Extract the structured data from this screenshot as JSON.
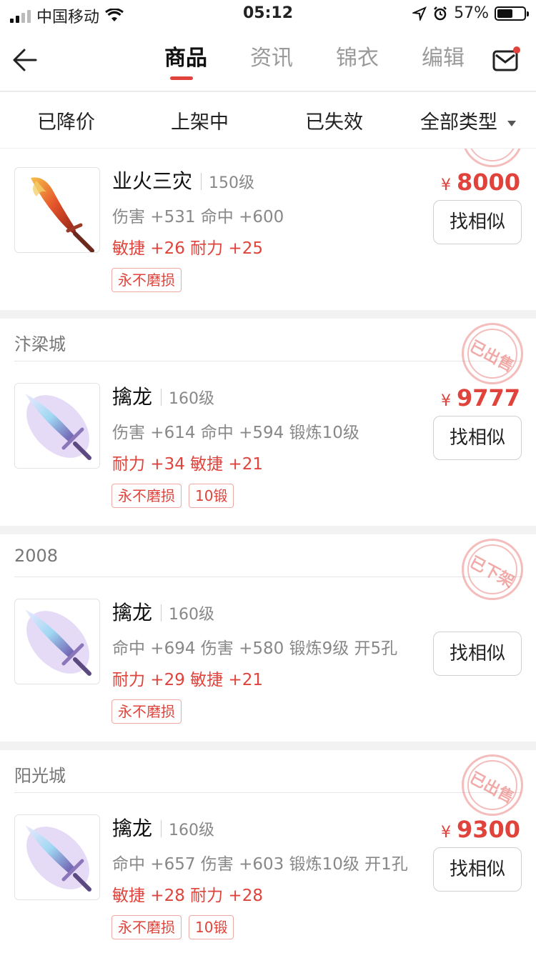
{
  "status_bar": {
    "carrier": "中国移动",
    "time": "05:12",
    "battery": "57%",
    "battery_level": 0.57
  },
  "nav": {
    "tabs": [
      {
        "label": "商品"
      },
      {
        "label": "资讯"
      },
      {
        "label": "锦衣"
      },
      {
        "label": "编辑"
      }
    ],
    "active_tab": 0
  },
  "filters": {
    "items": [
      "已降价",
      "上架中",
      "已失效"
    ],
    "dropdown_label": "全部类型"
  },
  "colors": {
    "accent": "#e0433b",
    "muted": "#888888"
  },
  "cards": [
    {
      "seller": "",
      "image_icon": "flame-blade-icon",
      "name": "业火三灾",
      "level": "150级",
      "stats1": "伤害 +531 命中 +600",
      "stats2": "敏捷 +26 耐力 +25",
      "tags": [
        "永不磨损"
      ],
      "price": "8000",
      "currency": "¥",
      "button": "找相似",
      "stamp": ""
    },
    {
      "seller": "汴梁城",
      "image_icon": "purple-sword-icon",
      "name": "擒龙",
      "level": "160级",
      "stats1": "伤害 +614 命中 +594 锻炼10级",
      "stats2": "耐力 +34 敏捷 +21",
      "tags": [
        "永不磨损",
        "10锻"
      ],
      "price": "9777",
      "currency": "¥",
      "button": "找相似",
      "stamp": "已出售"
    },
    {
      "seller": "2008",
      "image_icon": "purple-sword-icon",
      "name": "擒龙",
      "level": "160级",
      "stats1": "命中 +694 伤害 +580 锻炼9级 开5孔",
      "stats2": "耐力 +29 敏捷 +21",
      "tags": [
        "永不磨损"
      ],
      "price": "",
      "currency": "",
      "button": "找相似",
      "stamp": "已下架"
    },
    {
      "seller": "阳光城",
      "image_icon": "purple-sword-icon",
      "name": "擒龙",
      "level": "160级",
      "stats1": "命中 +657 伤害 +603 锻炼10级 开1孔",
      "stats2": "敏捷 +28 耐力 +28",
      "tags": [
        "永不磨损",
        "10锻"
      ],
      "price": "9300",
      "currency": "¥",
      "button": "找相似",
      "stamp": "已出售"
    }
  ]
}
